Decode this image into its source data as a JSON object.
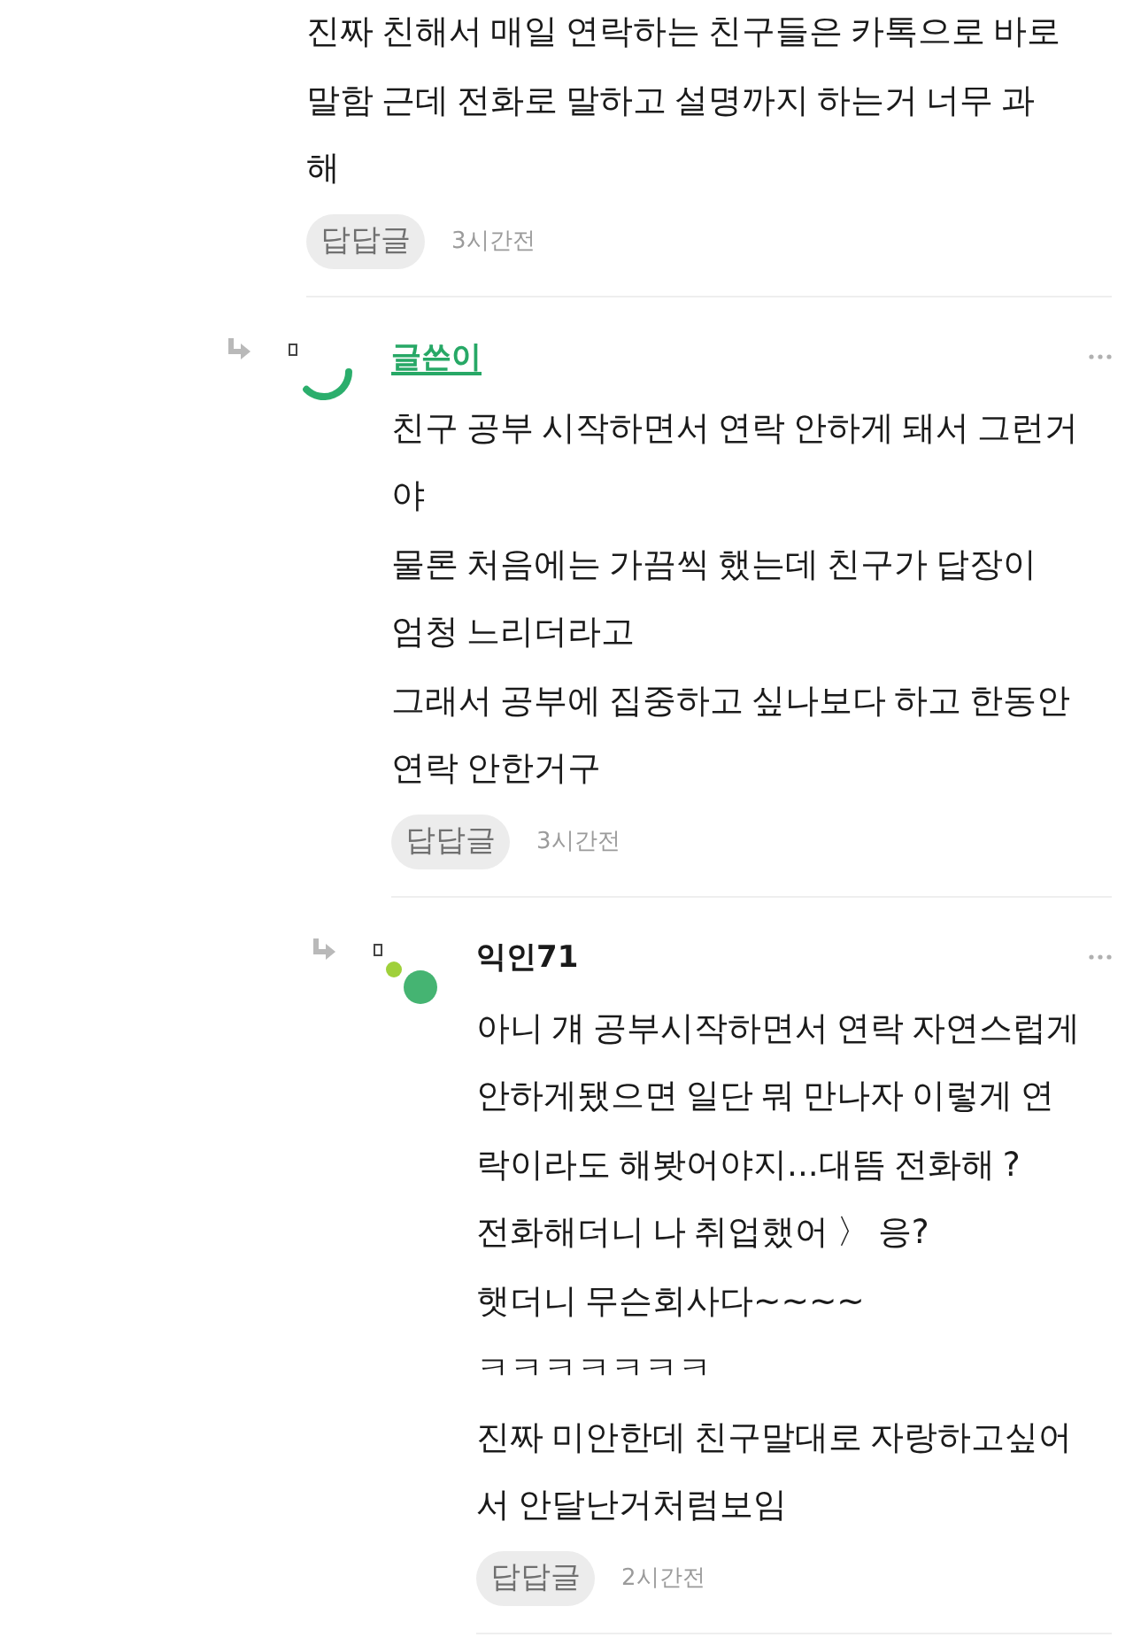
{
  "comments": [
    {
      "text": "진짜 친해서 매일 연락하는 친구들은 카톡으로 바로\n말함 근데 전화로 말하고 설명까지 하는거 너무 과\n해",
      "reply_button": "답답글",
      "time": "3시간전",
      "children": [
        {
          "author": "글쓴이",
          "is_writer": true,
          "avatar": {
            "kind": "arc"
          },
          "text": "친구 공부 시작하면서 연락 안하게 돼서 그런거\n야\n물론 처음에는 가끔씩 했는데 친구가 답장이\n엄청 느리더라고\n그래서 공부에 집중하고 싶나보다 하고 한동안\n연락 안한거구",
          "reply_button": "답답글",
          "time": "3시간전",
          "children": [
            {
              "author": "익인71",
              "is_writer": false,
              "avatar": {
                "kind": "dots"
              },
              "text": "아니 걔 공부시작하면서 연락 자연스럽게\n안하게됐으면 일단 뭐 만나자 이렇게 연\n락이라도 해봣어야지...대뜸 전화해 ?\n전화해더니 나 취업했어 〉 응?\n햇더니 무슨회사다~~~~\nㅋㅋㅋㅋㅋㅋㅋ\n진짜 미안한데 친구말대로 자랑하고싶어\n서 안달난거처럼보임",
              "reply_button": "답답글",
              "time": "2시간전"
            }
          ]
        }
      ]
    }
  ]
}
